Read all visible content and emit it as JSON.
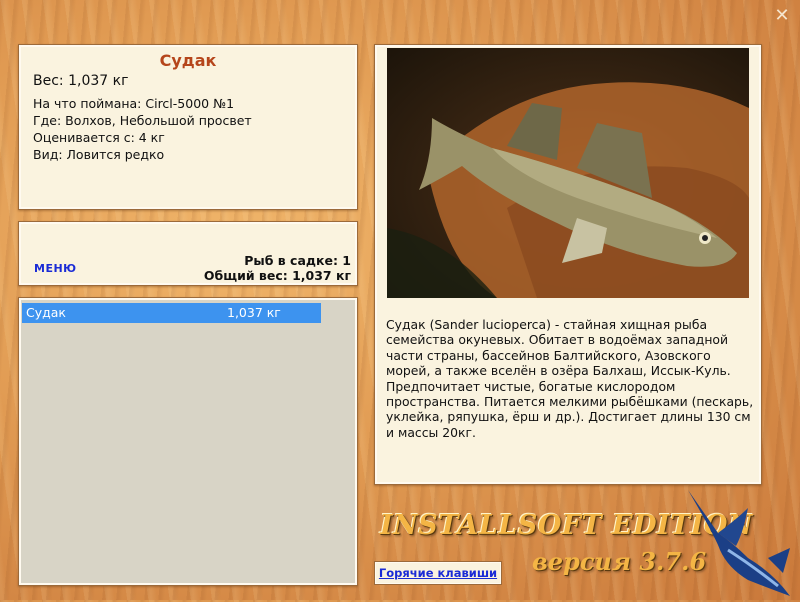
{
  "window": {
    "close_label": "✕"
  },
  "catch": {
    "title": "Судак",
    "weight": "Вес: 1,037 кг",
    "details": [
      "На что поймана: Circl-5000 №1",
      "Где: Волхов, Небольшой просвет",
      "Оценивается с: 4 кг",
      "Вид: Ловится редко"
    ]
  },
  "menu": {
    "label": "МЕНЮ",
    "fish_in_keepnet": "Рыб в садке: 1",
    "total_weight": "Общий вес: 1,037 кг"
  },
  "keepnet": {
    "rows": [
      {
        "name": "Судак",
        "weight": "1,037 кг"
      }
    ]
  },
  "fish_info": {
    "description": "Судак (Sander lucioperca) - стайная хищная рыба семейства окуневых. Обитает в водоёмах западной части страны, бассейнов Балтийского, Азовского морей, а также вселён в озёра Балхаш, Иссык-Куль. Предпочитает чистые, богатые кислородом пространства. Питается мелкими рыбёшками (пескарь, уклейка, ряпушка, ёрш и др.). Достигает длины 130 см и массы 20кг."
  },
  "footer": {
    "hotkeys_label": "Горячие клавиши",
    "edition": "INSTALLSOFT EDITION",
    "version": "версия 3.7.6"
  },
  "colors": {
    "title": "#b5451b",
    "link": "#1a2bd6",
    "selection": "#3d93ef",
    "panel": "#faf3df"
  }
}
